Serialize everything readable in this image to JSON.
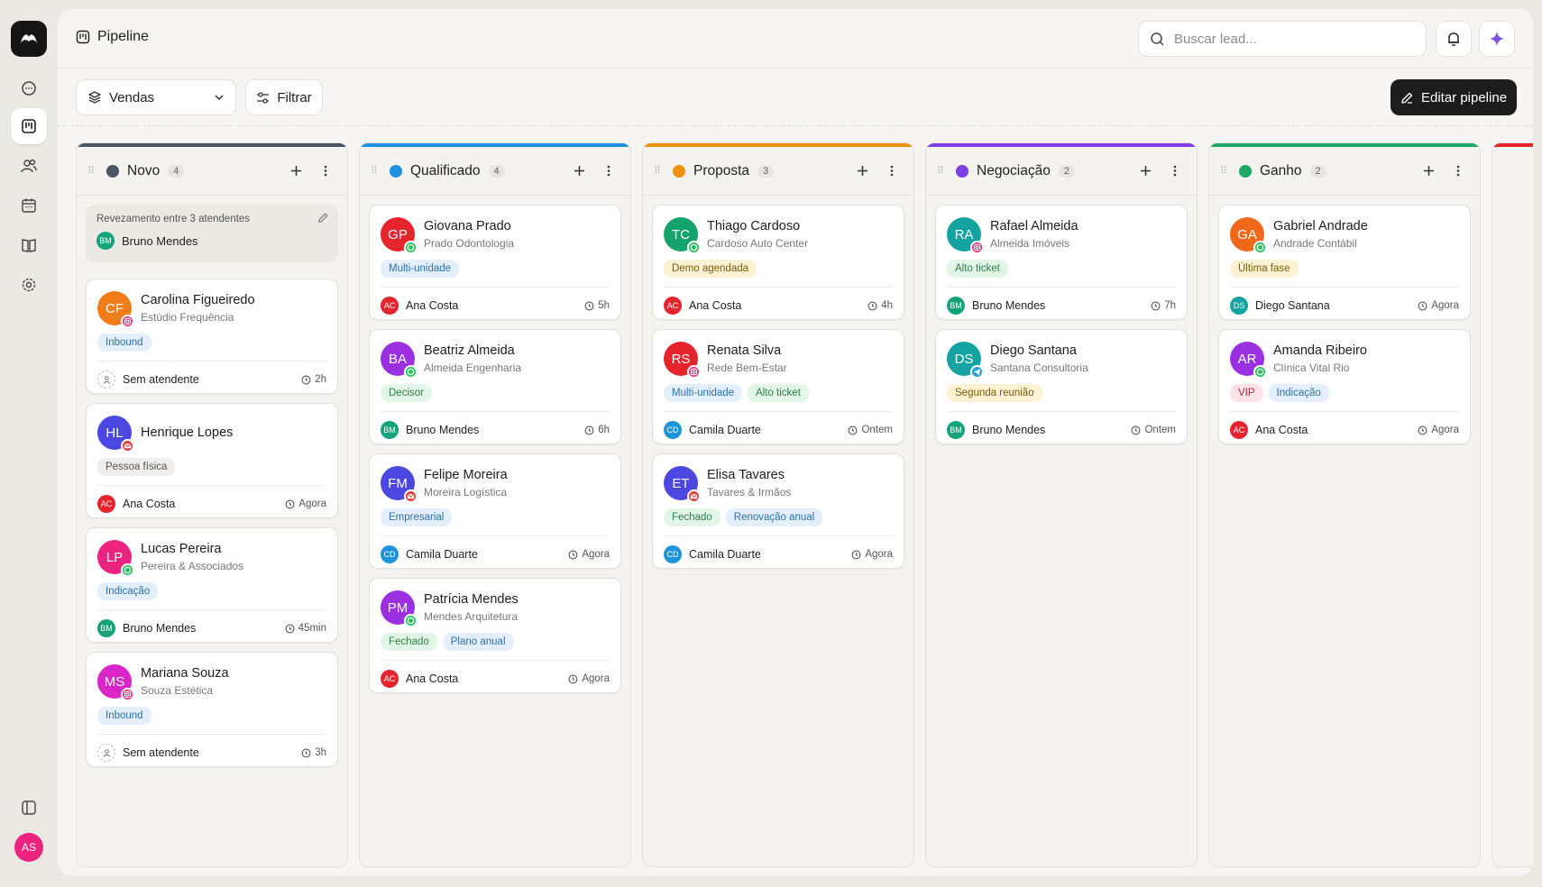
{
  "header": {
    "title": "Pipeline",
    "search_placeholder": "Buscar lead..."
  },
  "toolbar": {
    "pipeline_select": "Vendas",
    "filter_label": "Filtrar",
    "edit_label": "Editar pipeline"
  },
  "user": {
    "initials": "AS"
  },
  "tag_colors": {
    "Inbound": [
      "#e3f0fb",
      "#2f6fa8"
    ],
    "Pessoa física": [
      "#efeeeb",
      "#555555"
    ],
    "Indicação": [
      "#e3f0fb",
      "#2f6fa8"
    ],
    "Multi-unidade": [
      "#e3f0fb",
      "#2f6fa8"
    ],
    "Decisor": [
      "#e2f6e8",
      "#2f7d46"
    ],
    "Empresarial": [
      "#e3f0fb",
      "#2f6fa8"
    ],
    "Fechado": [
      "#e2f6e8",
      "#2f7d46"
    ],
    "Plano anual": [
      "#e3f0fb",
      "#2f6fa8"
    ],
    "Demo agendada": [
      "#fdf3d4",
      "#7a5a0c"
    ],
    "Alto ticket": [
      "#e2f6e8",
      "#2f7d46"
    ],
    "Renovação anual": [
      "#e3f0fb",
      "#2f6fa8"
    ],
    "Segunda reunião": [
      "#fdf3d4",
      "#7a5a0c"
    ],
    "Última fase": [
      "#fdf3d4",
      "#7a5a0c"
    ],
    "VIP": [
      "#fde3e7",
      "#b1243a"
    ]
  },
  "owner_colors": {
    "AC": "#e5242e",
    "BM": "#14a37a",
    "CD": "#1f93d9",
    "DS": "#14a3a0"
  },
  "columns": [
    {
      "name": "Novo",
      "count": "4",
      "color": "#4b5563",
      "rotation": {
        "title": "Revezamento entre 3 atendentes",
        "owner_initials": "BM",
        "owner": "Bruno Mendes"
      },
      "cards": [
        {
          "initials": "CF",
          "color": "#f07d1a",
          "channel": "instagram",
          "name": "Carolina Figueiredo",
          "company": "Estúdio Frequência",
          "tags": [
            "Inbound"
          ],
          "owner": "Sem atendente",
          "owner_initials": "",
          "time": "2h"
        },
        {
          "initials": "HL",
          "color": "#4b47e0",
          "channel": "email",
          "name": "Henrique Lopes",
          "company": "",
          "tags": [
            "Pessoa física"
          ],
          "owner": "Ana Costa",
          "owner_initials": "AC",
          "time": "Agora"
        },
        {
          "initials": "LP",
          "color": "#ec2480",
          "channel": "whatsapp",
          "name": "Lucas Pereira",
          "company": "Pereira & Associados",
          "tags": [
            "Indicação"
          ],
          "owner": "Bruno Mendes",
          "owner_initials": "BM",
          "time": "45min"
        },
        {
          "initials": "MS",
          "color": "#d826c8",
          "channel": "instagram",
          "name": "Mariana Souza",
          "company": "Souza Estética",
          "tags": [
            "Inbound"
          ],
          "owner": "Sem atendente",
          "owner_initials": "",
          "time": "3h"
        }
      ]
    },
    {
      "name": "Qualificado",
      "count": "4",
      "color": "#1f8fe0",
      "cards": [
        {
          "initials": "GP",
          "color": "#e5242e",
          "channel": "whatsapp",
          "name": "Giovana Prado",
          "company": "Prado Odontologia",
          "tags": [
            "Multi-unidade"
          ],
          "owner": "Ana Costa",
          "owner_initials": "AC",
          "time": "5h"
        },
        {
          "initials": "BA",
          "color": "#9b30e0",
          "channel": "whatsapp",
          "name": "Beatriz Almeida",
          "company": "Almeida Engenharia",
          "tags": [
            "Decisor"
          ],
          "owner": "Bruno Mendes",
          "owner_initials": "BM",
          "time": "6h"
        },
        {
          "initials": "FM",
          "color": "#4b47e0",
          "channel": "email",
          "name": "Felipe Moreira",
          "company": "Moreira Logística",
          "tags": [
            "Empresarial"
          ],
          "owner": "Camila Duarte",
          "owner_initials": "CD",
          "time": "Agora"
        },
        {
          "initials": "PM",
          "color": "#9b30e0",
          "channel": "whatsapp",
          "name": "Patrícia Mendes",
          "company": "Mendes Arquitetura",
          "tags": [
            "Fechado",
            "Plano anual"
          ],
          "owner": "Ana Costa",
          "owner_initials": "AC",
          "time": "Agora"
        }
      ]
    },
    {
      "name": "Proposta",
      "count": "3",
      "color": "#f0900f",
      "cards": [
        {
          "initials": "TC",
          "color": "#14a36a",
          "channel": "whatsapp",
          "name": "Thiago Cardoso",
          "company": "Cardoso Auto Center",
          "tags": [
            "Demo agendada"
          ],
          "owner": "Ana Costa",
          "owner_initials": "AC",
          "time": "4h"
        },
        {
          "initials": "RS",
          "color": "#e5242e",
          "channel": "instagram",
          "name": "Renata Silva",
          "company": "Rede Bem-Estar",
          "tags": [
            "Multi-unidade",
            "Alto ticket"
          ],
          "owner": "Camila Duarte",
          "owner_initials": "CD",
          "time": "Ontem"
        },
        {
          "initials": "ET",
          "color": "#4b47e0",
          "channel": "email",
          "name": "Elisa Tavares",
          "company": "Tavares & Irmãos",
          "tags": [
            "Fechado",
            "Renovação anual"
          ],
          "owner": "Camila Duarte",
          "owner_initials": "CD",
          "time": "Agora"
        }
      ]
    },
    {
      "name": "Negociação",
      "count": "2",
      "color": "#7b3fe4",
      "cards": [
        {
          "initials": "RA",
          "color": "#14a3a0",
          "channel": "instagram",
          "name": "Rafael Almeida",
          "company": "Almeida Imóveis",
          "tags": [
            "Alto ticket"
          ],
          "owner": "Bruno Mendes",
          "owner_initials": "BM",
          "time": "7h"
        },
        {
          "initials": "DS",
          "color": "#14a3a0",
          "channel": "telegram",
          "name": "Diego Santana",
          "company": "Santana Consultoria",
          "tags": [
            "Segunda reunião"
          ],
          "owner": "Bruno Mendes",
          "owner_initials": "BM",
          "time": "Ontem"
        }
      ]
    },
    {
      "name": "Ganho",
      "count": "2",
      "color": "#1fa865",
      "cards": [
        {
          "initials": "GA",
          "color": "#f0681a",
          "channel": "whatsapp",
          "name": "Gabriel Andrade",
          "company": "Andrade Contábil",
          "tags": [
            "Última fase"
          ],
          "owner": "Diego Santana",
          "owner_initials": "DS",
          "time": "Agora"
        },
        {
          "initials": "AR",
          "color": "#9b30e0",
          "channel": "whatsapp",
          "name": "Amanda Ribeiro",
          "company": "Clínica Vital Rio",
          "tags": [
            "VIP",
            "Indicação"
          ],
          "owner": "Ana Costa",
          "owner_initials": "AC",
          "time": "Agora"
        }
      ]
    }
  ]
}
